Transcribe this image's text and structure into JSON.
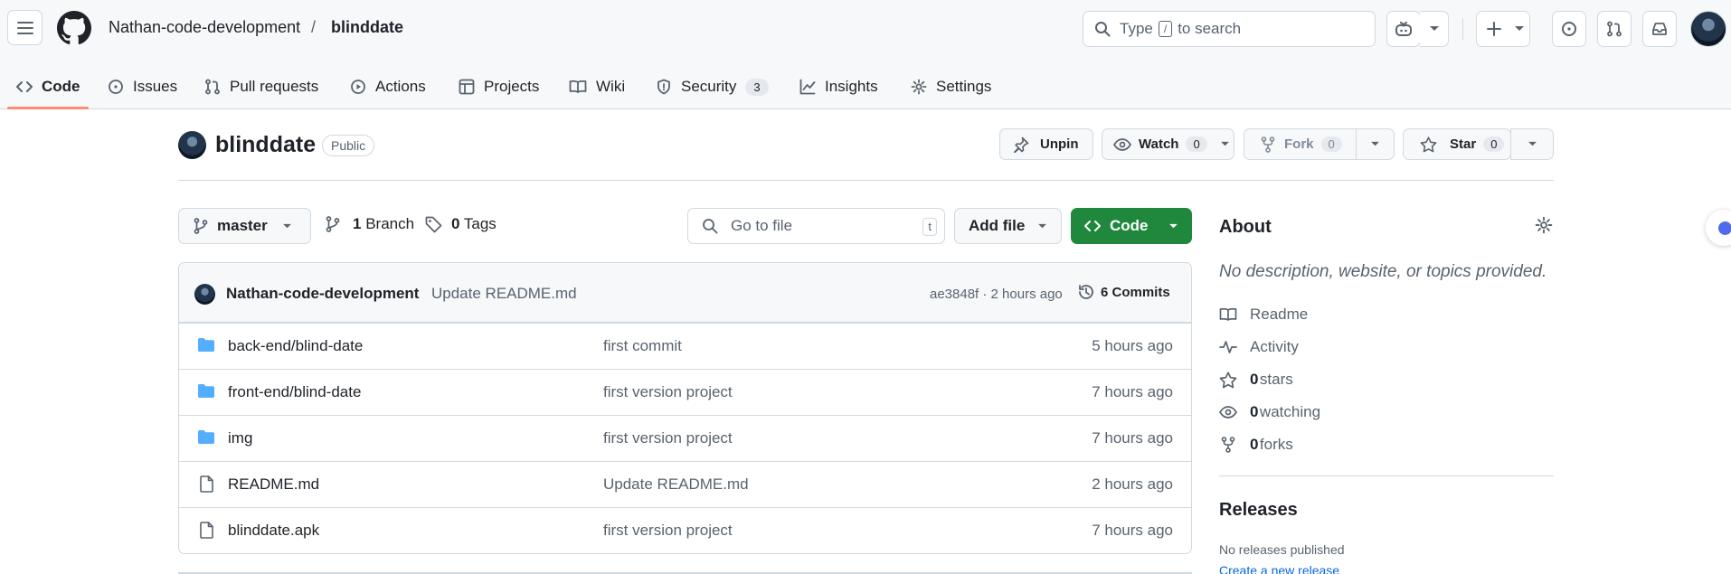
{
  "header": {
    "owner": "Nathan-code-development",
    "separator": "/",
    "repo": "blinddate",
    "search_prefix": "Type",
    "search_key": "/",
    "search_suffix": "to search"
  },
  "tabs": [
    {
      "label": "Code",
      "icon": "code-icon"
    },
    {
      "label": "Issues",
      "icon": "issue-icon"
    },
    {
      "label": "Pull requests",
      "icon": "pull-request-icon"
    },
    {
      "label": "Actions",
      "icon": "play-icon"
    },
    {
      "label": "Projects",
      "icon": "table-icon"
    },
    {
      "label": "Wiki",
      "icon": "book-icon"
    },
    {
      "label": "Security",
      "icon": "shield-icon",
      "count": "3"
    },
    {
      "label": "Insights",
      "icon": "graph-icon"
    },
    {
      "label": "Settings",
      "icon": "gear-icon"
    }
  ],
  "repo_header": {
    "name": "blinddate",
    "visibility": "Public",
    "unpin_label": "Unpin",
    "watch_label": "Watch",
    "watch_count": "0",
    "fork_label": "Fork",
    "fork_count": "0",
    "star_label": "Star",
    "star_count": "0"
  },
  "file_nav": {
    "branch": "master",
    "branch_count": "1",
    "branch_label": "Branch",
    "tag_count": "0",
    "tag_label": "Tags",
    "goto_placeholder": "Go to file",
    "goto_key": "t",
    "add_file_label": "Add file",
    "code_label": "Code"
  },
  "latest_commit": {
    "author": "Nathan-code-development",
    "message": "Update README.md",
    "hash_time": "ae3848f · 2 hours ago",
    "commits_label": "6 Commits"
  },
  "files": [
    {
      "name": "back-end/blind-date",
      "type": "folder",
      "message": "first commit",
      "time": "5 hours ago"
    },
    {
      "name": "front-end/blind-date",
      "type": "folder",
      "message": "first version project",
      "time": "7 hours ago"
    },
    {
      "name": "img",
      "type": "folder",
      "message": "first version project",
      "time": "7 hours ago"
    },
    {
      "name": "README.md",
      "type": "file",
      "message": "Update README.md",
      "time": "2 hours ago"
    },
    {
      "name": "blinddate.apk",
      "type": "file",
      "message": "first version project",
      "time": "7 hours ago"
    }
  ],
  "about": {
    "title": "About",
    "description": "No description, website, or topics provided.",
    "readme": "Readme",
    "activity": "Activity",
    "stars_count": "0",
    "stars_label": "stars",
    "watching_count": "0",
    "watching_label": "watching",
    "forks_count": "0",
    "forks_label": "forks"
  },
  "releases": {
    "title": "Releases",
    "none_text": "No releases published",
    "create_link": "Create a new release"
  },
  "colors": {
    "accent_green": "#1f883d",
    "link_blue": "#0969da",
    "folder_blue": "#54aeff",
    "tab_underline": "#fd8c73"
  }
}
